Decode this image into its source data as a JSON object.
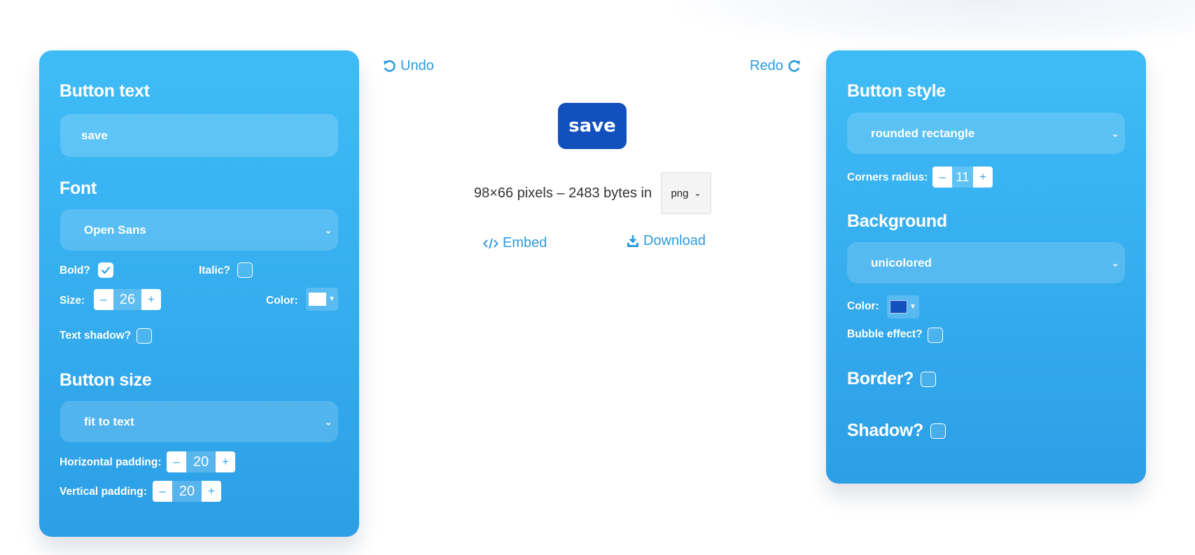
{
  "toolbar": {
    "undo_label": "Undo",
    "redo_label": "Redo"
  },
  "preview": {
    "button_text": "save",
    "info_text": "98×66 pixels – 2483 bytes in",
    "format_value": "png",
    "embed_label": "Embed",
    "download_label": "Download"
  },
  "left_panel": {
    "button_text_heading": "Button text",
    "button_text_value": "save",
    "font_heading": "Font",
    "font_value": "Open Sans",
    "bold_label": "Bold?",
    "bold_checked": true,
    "italic_label": "Italic?",
    "italic_checked": false,
    "size_label": "Size:",
    "size_value": "26",
    "color_label": "Color:",
    "text_color": "#ffffff",
    "text_shadow_label": "Text shadow?",
    "button_size_heading": "Button size",
    "button_size_value": "fit to text",
    "hpad_label": "Horizontal padding:",
    "hpad_value": "20",
    "vpad_label": "Vertical padding:",
    "vpad_value": "20"
  },
  "right_panel": {
    "style_heading": "Button style",
    "style_value": "rounded rectangle",
    "radius_label": "Corners radius:",
    "radius_value": "11",
    "background_heading": "Background",
    "background_value": "unicolored",
    "color_label": "Color:",
    "bg_color": "#1251bd",
    "bubble_label": "Bubble effect?",
    "border_label": "Border?",
    "shadow_label": "Shadow?"
  },
  "stepper": {
    "minus": "–",
    "plus": "+"
  },
  "colors": {
    "accent": "#2b9be0",
    "panel_top": "#3fbcf7",
    "panel_bottom": "#2c9fe6"
  }
}
